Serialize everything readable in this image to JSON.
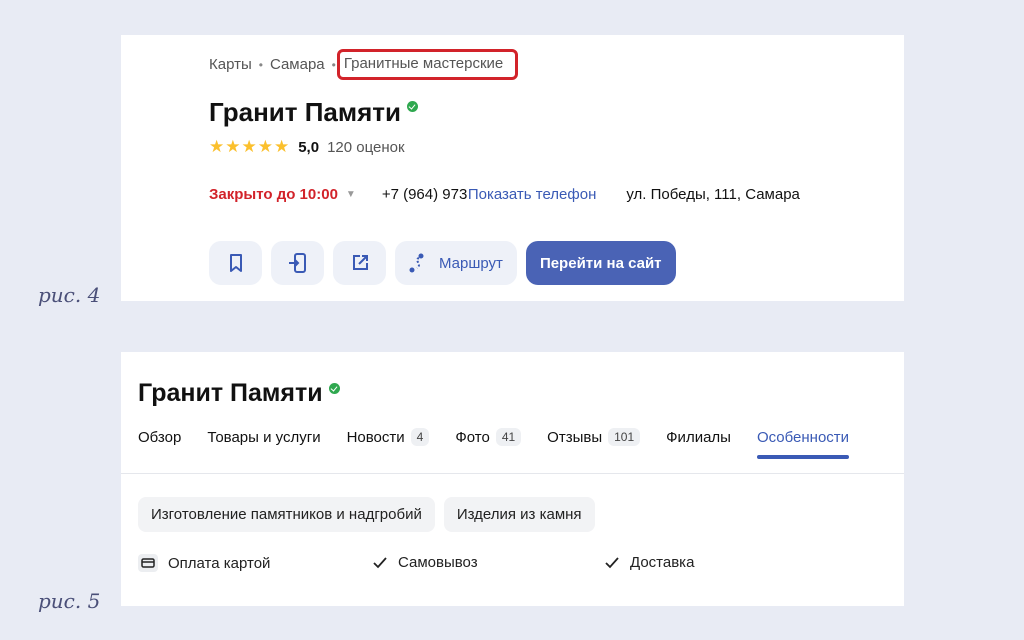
{
  "figure1": {
    "caption": "рис. 4",
    "breadcrumb": [
      "Карты",
      "Самара",
      "Гранитные мастерские"
    ],
    "title": "Гранит Памяти",
    "rating": {
      "stars": "★★★★★",
      "score": "5,0",
      "count": "120 оценок"
    },
    "status": "Закрыто до 10:00",
    "phone": "+7 (964) 973",
    "show_phone": "Показать телефон",
    "address": "ул. Победы, 111, Самара",
    "route_label": "Маршрут",
    "site_label": "Перейти на сайт",
    "colors": {
      "accent": "#4a63b5",
      "closed": "#d2232a",
      "highlight": "#d2232a",
      "verified": "#2fa84f"
    }
  },
  "figure2": {
    "caption": "рис. 5",
    "title": "Гранит Памяти",
    "tabs": [
      {
        "label": "Обзор",
        "badge": ""
      },
      {
        "label": "Товары и услуги",
        "badge": ""
      },
      {
        "label": "Новости",
        "badge": "4"
      },
      {
        "label": "Фото",
        "badge": "41"
      },
      {
        "label": "Отзывы",
        "badge": "101"
      },
      {
        "label": "Филиалы",
        "badge": ""
      },
      {
        "label": "Особенности",
        "badge": "",
        "active": true
      }
    ],
    "chips": [
      "Изготовление памятников и надгробий",
      "Изделия из камня"
    ],
    "features": [
      "Оплата картой",
      "Самовывоз",
      "Доставка"
    ]
  }
}
